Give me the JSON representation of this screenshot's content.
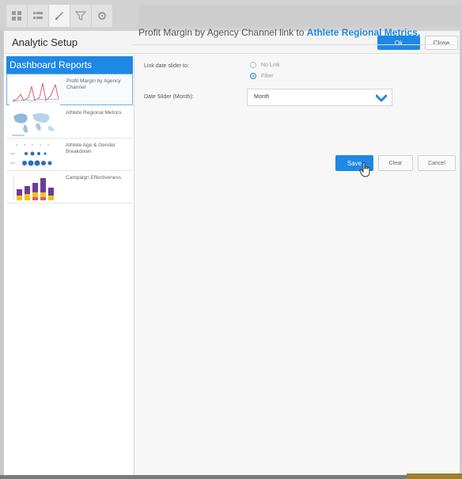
{
  "toolbar": {
    "icons": [
      "grid-icon",
      "list-icon",
      "brush-icon",
      "filter-icon",
      "gear-icon"
    ]
  },
  "panel": {
    "title": "Analytic Setup",
    "ok_label": "Ok",
    "close_label": "Close"
  },
  "sidebar": {
    "title": "Dashboard Reports",
    "items": [
      {
        "label": "Profit Margin by Agency Channel",
        "selected": true
      },
      {
        "label": "Athlete Regional Metrics",
        "selected": false
      },
      {
        "label": "Athlete Age & Gender Breakdown",
        "selected": false
      },
      {
        "label": "Campaign Effectiveness",
        "selected": false
      }
    ]
  },
  "main": {
    "heading_prefix": "Profit Margin by Agency Channel link to",
    "heading_link": "Athlete Regional Metrics.",
    "link_date_label": "Link date slider to:",
    "options": [
      "No Link",
      "Filter"
    ],
    "selected_option": "Filter",
    "date_slider_label": "Date Slider (Month):",
    "date_slider_value": "Month",
    "save_label": "Save",
    "clear_label": "Clear",
    "cancel_label": "Cancel"
  },
  "colors": {
    "accent": "#1e88e5"
  }
}
